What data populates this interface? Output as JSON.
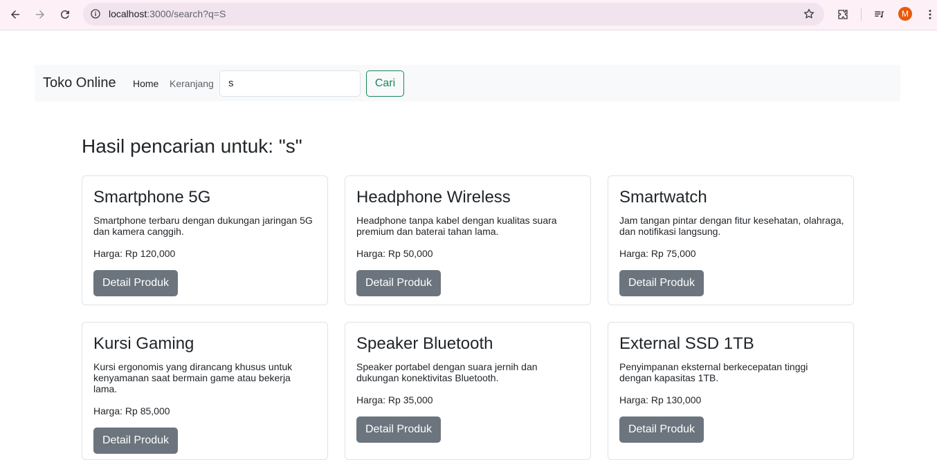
{
  "browser": {
    "url_host": "localhost",
    "url_path": ":3000/search?q=S",
    "profile_initial": "M"
  },
  "navbar": {
    "brand": "Toko Online",
    "home": "Home",
    "cart": "Keranjang",
    "search_value": "s",
    "search_button": "Cari"
  },
  "results": {
    "title": "Hasil pencarian untuk: \"s\""
  },
  "products": [
    {
      "name": "Smartphone 5G",
      "description": "Smartphone terbaru dengan dukungan jaringan 5G dan kamera canggih.",
      "price": "Harga: Rp 120,000",
      "button": "Detail Produk"
    },
    {
      "name": "Headphone Wireless",
      "description": "Headphone tanpa kabel dengan kualitas suara premium dan baterai tahan lama.",
      "price": "Harga: Rp 50,000",
      "button": "Detail Produk"
    },
    {
      "name": "Smartwatch",
      "description": "Jam tangan pintar dengan fitur kesehatan, olahraga, dan notifikasi langsung.",
      "price": "Harga: Rp 75,000",
      "button": "Detail Produk"
    },
    {
      "name": "Kursi Gaming",
      "description": "Kursi ergonomis yang dirancang khusus untuk kenyamanan saat bermain game atau bekerja lama.",
      "price": "Harga: Rp 85,000",
      "button": "Detail Produk"
    },
    {
      "name": "Speaker Bluetooth",
      "description": "Speaker portabel dengan suara jernih dan dukungan konektivitas Bluetooth.",
      "price": "Harga: Rp 35,000",
      "button": "Detail Produk"
    },
    {
      "name": "External SSD 1TB",
      "description": "Penyimpanan eksternal berkecepatan tinggi dengan kapasitas 1TB.",
      "price": "Harga: Rp 130,000",
      "button": "Detail Produk"
    }
  ]
}
